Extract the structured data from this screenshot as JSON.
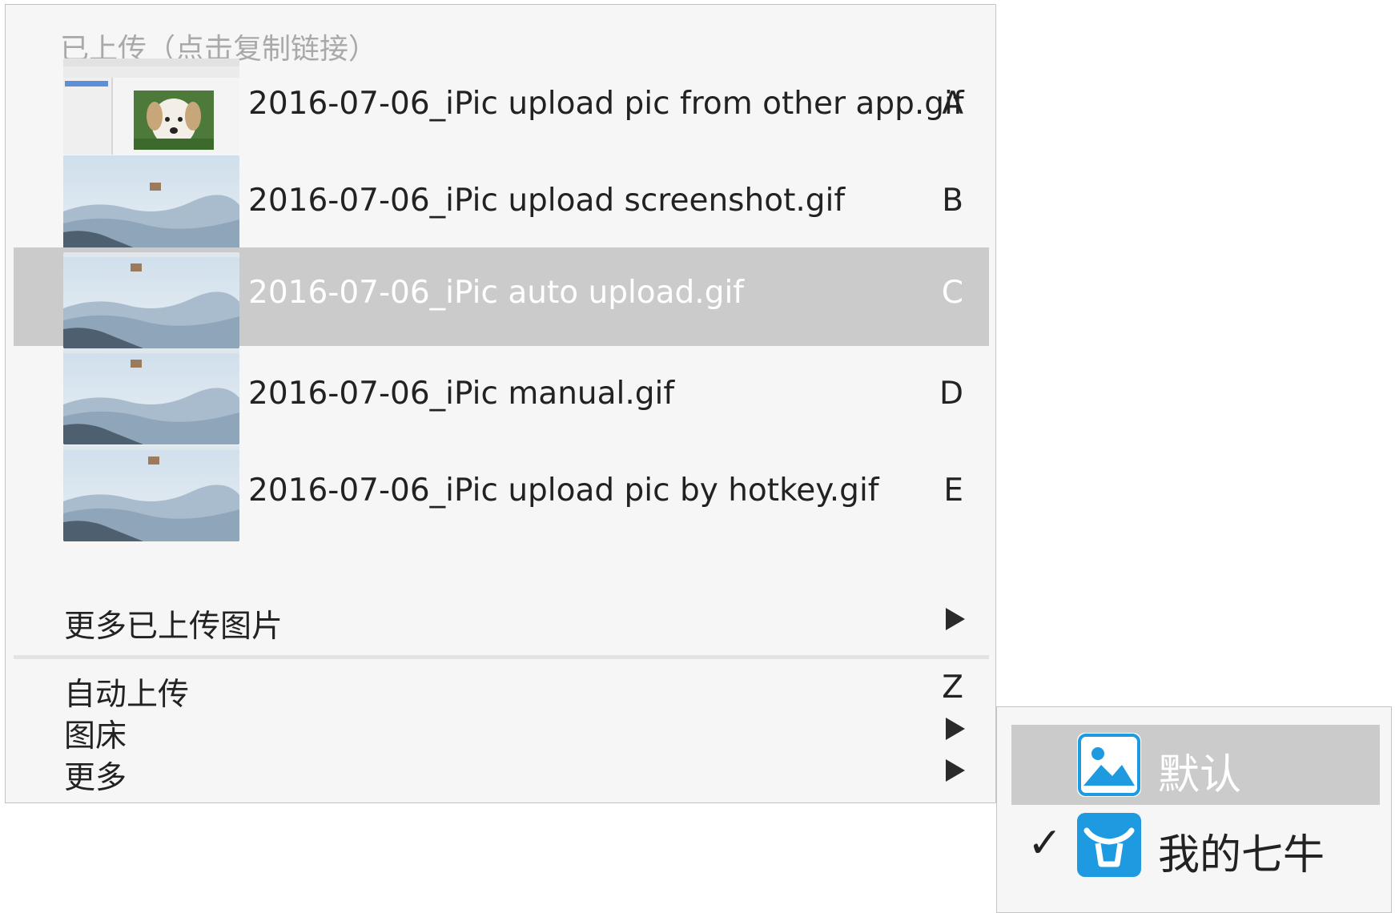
{
  "menu": {
    "header": "已上传（点击复制链接）",
    "recent_uploads": [
      {
        "label": "2016-07-06_iPic upload pic from other app.gif",
        "shortcut": "A",
        "thumbnail": "puppy-app-screenshot",
        "selected": false
      },
      {
        "label": "2016-07-06_iPic upload screenshot.gif",
        "shortcut": "B",
        "thumbnail": "misty-mountains",
        "selected": false
      },
      {
        "label": "2016-07-06_iPic auto upload.gif",
        "shortcut": "C",
        "thumbnail": "misty-mountains",
        "selected": true
      },
      {
        "label": "2016-07-06_iPic manual.gif",
        "shortcut": "D",
        "thumbnail": "misty-mountains",
        "selected": false
      },
      {
        "label": "2016-07-06_iPic upload pic by hotkey.gif",
        "shortcut": "E",
        "thumbnail": "misty-mountains",
        "selected": false
      }
    ],
    "more_uploaded": {
      "label": "更多已上传图片",
      "icon": "submenu-arrow-icon"
    },
    "auto_upload": {
      "label": "自动上传",
      "shortcut": "Z"
    },
    "image_host": {
      "label": "图床",
      "icon": "submenu-arrow-icon"
    },
    "more": {
      "label": "更多",
      "icon": "submenu-arrow-icon"
    }
  },
  "submenu": {
    "items": [
      {
        "label": "默认",
        "icon": "picture-icon",
        "selected": true,
        "checked": false
      },
      {
        "label": "我的七牛",
        "icon": "qiniu-icon",
        "selected": false,
        "checked": true
      }
    ],
    "check_mark": "✓"
  },
  "colors": {
    "highlight": "#cbcbcb",
    "menu_bg": "#f6f6f6",
    "icon_blue": "#1e9ae0"
  }
}
